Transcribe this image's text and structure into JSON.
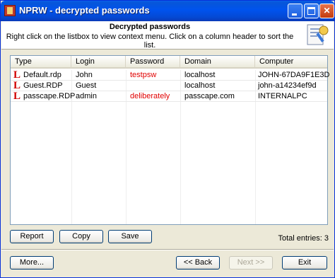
{
  "window": {
    "title": "NPRW - decrypted passwords"
  },
  "header": {
    "title": "Decrypted passwords",
    "subtitle": "Right click on the listbox to view context menu. Click on a column header to sort the list.",
    "icon": "key-document-icon"
  },
  "list": {
    "columns": [
      "Type",
      "Login",
      "Password",
      "Domain",
      "Computer"
    ],
    "rows": [
      {
        "icon": "L",
        "type": "Default.rdp",
        "login": "John",
        "password": "testpsw",
        "domain": "localhost",
        "computer": "JOHN-67DA9F1E3D"
      },
      {
        "icon": "L",
        "type": "Guest.RDP",
        "login": "Guest",
        "password": "",
        "domain": "localhost",
        "computer": "john-a14234ef9d"
      },
      {
        "icon": "L",
        "type": "passcape.RDP",
        "login": "admin",
        "password": "deliberately",
        "domain": "passcape.com",
        "computer": "INTERNALPC"
      }
    ]
  },
  "buttons": {
    "report": "Report",
    "copy": "Copy",
    "save": "Save",
    "more": "More...",
    "back": "<< Back",
    "next": "Next >>",
    "exit": "Exit"
  },
  "status": {
    "total": "Total entries: 3"
  },
  "colors": {
    "password": "#e00000",
    "row_icon": "#d00000",
    "titlebar": "#0053ee"
  }
}
